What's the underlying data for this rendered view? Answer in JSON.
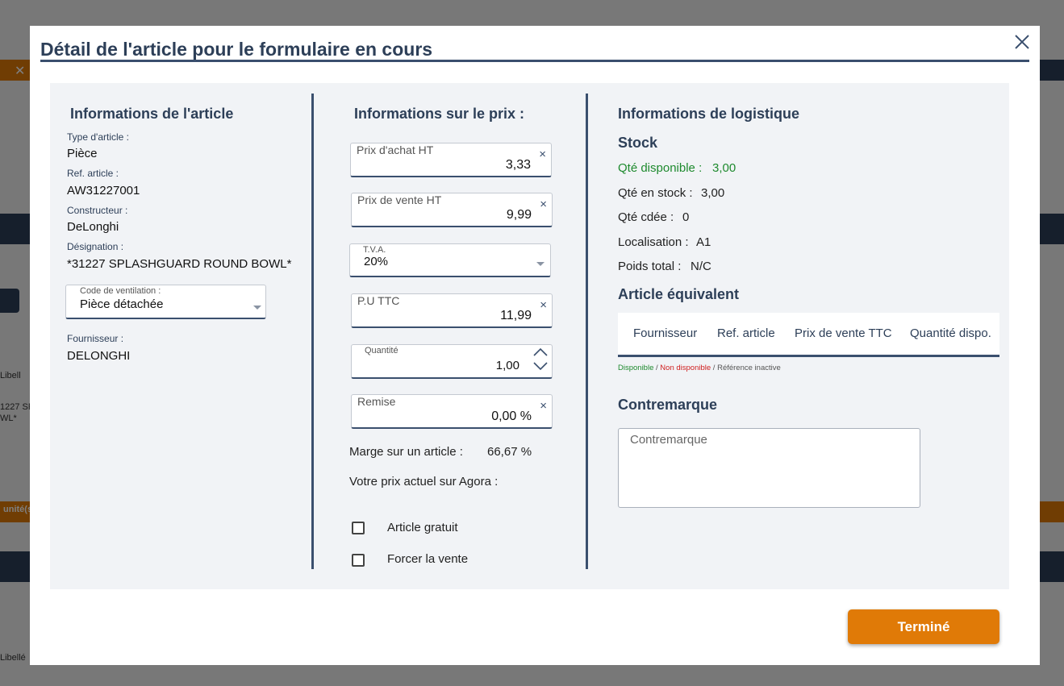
{
  "background": {
    "close_glyph": "✕",
    "texts": [
      "Libell",
      "1227 SPL",
      "WL*",
      "unité(s",
      "Libellé"
    ]
  },
  "modal": {
    "title": "Détail de l'article pour le formulaire en cours",
    "close_icon": "close-icon",
    "done_label": "Terminé"
  },
  "article": {
    "title": "Informations de l'article",
    "type_label": "Type d'article :",
    "type_value": "Pièce",
    "ref_label": "Ref. article :",
    "ref_value": "AW31227001",
    "maker_label": "Constructeur :",
    "maker_value": "DeLonghi",
    "desig_label": "Désignation :",
    "desig_value": "*31227 SPLASHGUARD ROUND BOWL*",
    "ventil_label": "Code de ventilation :",
    "ventil_value": "Pièce détachée",
    "supplier_label": "Fournisseur :",
    "supplier_value": "DELONGHI"
  },
  "price": {
    "title": "Informations sur le prix :",
    "purchase_label": "Prix d'achat HT",
    "purchase_value": "3,33",
    "sale_label": "Prix de vente HT",
    "sale_value": "9,99",
    "tva_label": "T.V.A.",
    "tva_value": "20%",
    "pu_label": "P.U TTC",
    "pu_value": "11,99",
    "qty_label": "Quantité",
    "qty_value": "1,00",
    "discount_label": "Remise",
    "discount_value": "0,00 %",
    "margin_label": "Marge sur un article :",
    "margin_value": "66,67 %",
    "agora_label": "Votre prix actuel sur Agora :",
    "free_label": "Article gratuit",
    "force_label": "Forcer la vente",
    "clear_glyph": "×",
    "up_glyph": "︿",
    "down_glyph": "﹀"
  },
  "logistics": {
    "title": "Informations de logistique",
    "stock_title": "Stock",
    "available_label": "Qté disponible :",
    "available_value": "3,00",
    "stock_label": "Qté en stock :",
    "stock_value": "3,00",
    "ordered_label": "Qté cdée :",
    "ordered_value": "0",
    "location_label": "Localisation :",
    "location_value": "A1",
    "weight_label": "Poids total :",
    "weight_value": "N/C",
    "equiv_title": "Article équivalent",
    "equiv_columns": [
      "Fournisseur",
      "Ref. article",
      "Prix de vente TTC",
      "Quantité dispo."
    ],
    "legend_available": "Disponible",
    "legend_sep": " / ",
    "legend_unavailable": "Non disponible",
    "legend_inactive": "Référence inactive",
    "counter_title": "Contremarque",
    "counter_placeholder": "Contremarque"
  },
  "colors": {
    "navy": "#3a4f6e",
    "title": "#2d3f58",
    "accent": "#e07a07",
    "available": "#1e8a2e",
    "unavailable": "#d02020"
  }
}
